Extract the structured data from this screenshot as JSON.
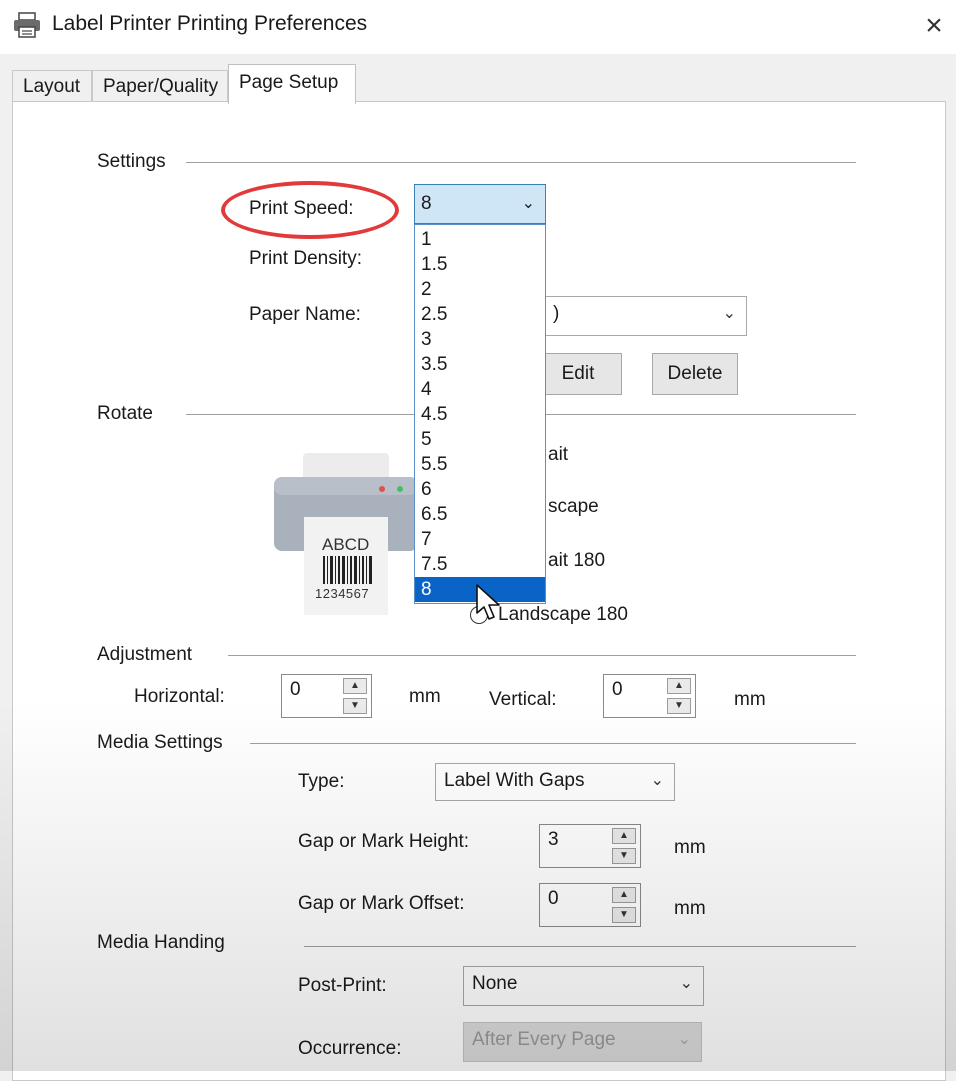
{
  "window": {
    "title": "Label Printer Printing Preferences",
    "close_glyph": "×",
    "icon": "printer-icon"
  },
  "tabs": [
    {
      "label": "Layout",
      "active": false
    },
    {
      "label": "Paper/Quality",
      "active": false
    },
    {
      "label": "Page Setup",
      "active": true
    }
  ],
  "settings": {
    "section_label": "Settings",
    "print_speed_label": "Print Speed:",
    "print_speed_value": "8",
    "print_speed_options": [
      "1",
      "1.5",
      "2",
      "2.5",
      "3",
      "3.5",
      "4",
      "4.5",
      "5",
      "5.5",
      "6",
      "6.5",
      "7",
      "7.5",
      "8"
    ],
    "print_speed_selected_index": 14,
    "print_density_label": "Print Density:",
    "paper_name_label": "Paper Name:",
    "paper_name_value_fragment": ")",
    "edit_button": "Edit",
    "delete_button": "Delete"
  },
  "rotate": {
    "section_label": "Rotate",
    "preview_text": "ABCD",
    "preview_barcode_number": "1234567",
    "options_visible": [
      "ait",
      "scape",
      "ait 180",
      "Landscape 180"
    ]
  },
  "adjustment": {
    "section_label": "Adjustment",
    "horizontal_label": "Horizontal:",
    "horizontal_value": "0",
    "horizontal_unit": "mm",
    "vertical_label": "Vertical:",
    "vertical_value": "0",
    "vertical_unit": "mm"
  },
  "media_settings": {
    "section_label": "Media Settings",
    "type_label": "Type:",
    "type_value": "Label With Gaps",
    "gap_height_label": "Gap or Mark Height:",
    "gap_height_value": "3",
    "gap_height_unit": "mm",
    "gap_offset_label": "Gap or Mark Offset:",
    "gap_offset_value": "0",
    "gap_offset_unit": "mm"
  },
  "media_handling": {
    "section_label": "Media Handing",
    "post_print_label": "Post-Print:",
    "post_print_value": "None",
    "occurrence_label": "Occurrence:",
    "occurrence_value": "After Every Page"
  },
  "colors": {
    "highlight": "#0a64c8",
    "annotation_oval": "#e23a3a"
  }
}
